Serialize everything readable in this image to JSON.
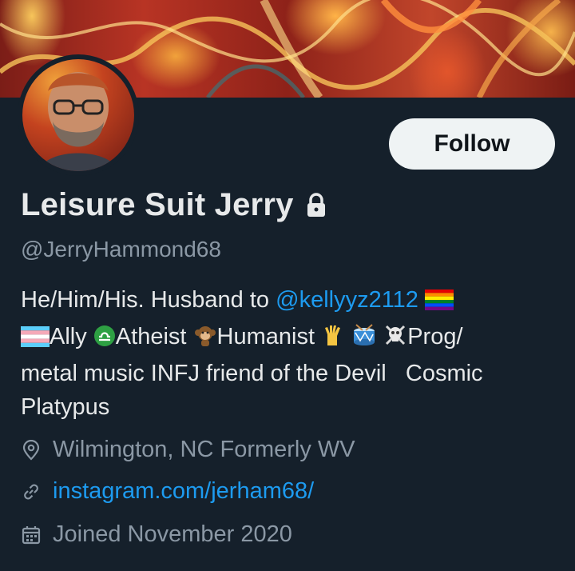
{
  "profile": {
    "display_name": "Leisure Suit Jerry",
    "handle": "@JerryHammond68",
    "follow_label": "Follow",
    "bio": {
      "line1_prefix": "He/Him/His. Husband to ",
      "mention": "@kellyyz2112",
      "line2_ally": "Ally",
      "line2_atheist": "Atheist",
      "line2_humanist": "Humanist",
      "line2_prog": "Prog/",
      "line3": "metal music INFJ friend of the Devil   Cosmic",
      "line4": "Platypus"
    },
    "location": "Wilmington, NC Formerly WV",
    "website": "instagram.com/jerham68/",
    "joined": "Joined November 2020"
  },
  "colors": {
    "background": "#15202b",
    "accent": "#1d9bf0",
    "secondary_text": "#8b98a5",
    "button_bg": "#eff3f4"
  },
  "icons": {
    "lock": "lock-icon",
    "location": "location-pin-icon",
    "link": "link-icon",
    "calendar": "calendar-icon"
  }
}
